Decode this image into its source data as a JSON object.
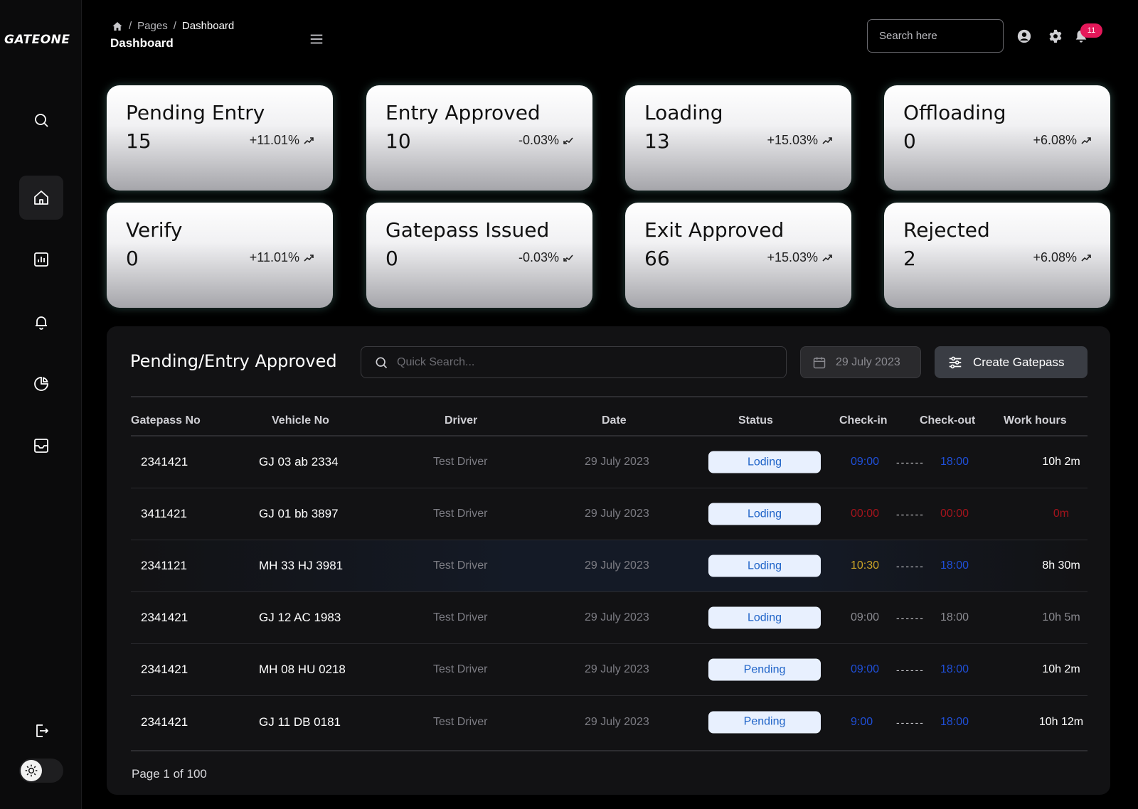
{
  "app": {
    "logo": "GATEONE"
  },
  "header": {
    "breadcrumb": [
      "Pages",
      "Dashboard"
    ],
    "title": "Dashboard",
    "search_placeholder": "Search here",
    "notification_count": "11"
  },
  "cards": [
    {
      "title": "Pending Entry",
      "value": "15",
      "change": "+11.01%",
      "trend": "up"
    },
    {
      "title": "Entry Approved",
      "value": "10",
      "change": "-0.03%",
      "trend": "down"
    },
    {
      "title": "Loading",
      "value": "13",
      "change": "+15.03%",
      "trend": "up"
    },
    {
      "title": "Offloading",
      "value": "0",
      "change": "+6.08%",
      "trend": "up"
    },
    {
      "title": "Verify",
      "value": "0",
      "change": "+11.01%",
      "trend": "up"
    },
    {
      "title": "Gatepass Issued",
      "value": "0",
      "change": "-0.03%",
      "trend": "down"
    },
    {
      "title": "Exit Approved",
      "value": "66",
      "change": "+15.03%",
      "trend": "up"
    },
    {
      "title": "Rejected",
      "value": "2",
      "change": "+6.08%",
      "trend": "up"
    }
  ],
  "table": {
    "title": "Pending/Entry Approved",
    "search_placeholder": "Quick Search...",
    "date": "29 July 2023",
    "create_label": "Create Gatepass",
    "columns": [
      "Gatepass No",
      "Vehicle No",
      "Driver",
      "Date",
      "Status",
      "Check-in",
      "Check-out",
      "Work hours"
    ],
    "separator": "------",
    "rows": [
      {
        "gatepass": "2341421",
        "vehicle": "GJ 03 ab 2334",
        "driver": "Test Driver",
        "date": "29 July 2023",
        "status": "Loding",
        "checkin": "09:00",
        "checkout": "18:00",
        "work": "10h 2m",
        "in_color": "#1f4fd8",
        "out_color": "#1f4fd8",
        "work_color": "#ffffff"
      },
      {
        "gatepass": "3411421",
        "vehicle": "GJ 01 bb 3897",
        "driver": "Test Driver",
        "date": "29 July 2023",
        "status": "Loding",
        "checkin": "00:00",
        "checkout": "00:00",
        "work": "0m",
        "in_color": "#a3141c",
        "out_color": "#a3141c",
        "work_color": "#a3141c"
      },
      {
        "gatepass": "2341121",
        "vehicle": "MH 33 HJ 3981",
        "driver": "Test Driver",
        "date": "29 July 2023",
        "status": "Loding",
        "checkin": "10:30",
        "checkout": "18:00",
        "work": "8h 30m",
        "in_color": "#c9a227",
        "out_color": "#1f4fd8",
        "work_color": "#ffffff"
      },
      {
        "gatepass": "2341421",
        "vehicle": "GJ 12 AC 1983",
        "driver": "Test Driver",
        "date": "29 July 2023",
        "status": "Loding",
        "checkin": "09:00",
        "checkout": "18:00",
        "work": "10h 5m",
        "in_color": "#8a8a90",
        "out_color": "#8a8a90",
        "work_color": "#8a8a90"
      },
      {
        "gatepass": "2341421",
        "vehicle": "MH 08 HU 0218",
        "driver": "Test Driver",
        "date": "29 July 2023",
        "status": "Pending",
        "checkin": "09:00",
        "checkout": "18:00",
        "work": "10h 2m",
        "in_color": "#1f4fd8",
        "out_color": "#1f4fd8",
        "work_color": "#ffffff"
      },
      {
        "gatepass": "2341421",
        "vehicle": "GJ 11 DB 0181",
        "driver": "Test Driver",
        "date": "29 July 2023",
        "status": "Pending",
        "checkin": "9:00",
        "checkout": "18:00",
        "work": "10h 12m",
        "in_color": "#1f4fd8",
        "out_color": "#1f4fd8",
        "work_color": "#ffffff"
      }
    ],
    "pagination": "Page 1 of 100"
  },
  "icons": {
    "sidebar": [
      "search-icon",
      "home-icon",
      "chart-icon",
      "bell-icon",
      "pie-chart-icon",
      "inbox-icon",
      "logout-icon",
      "sun-icon"
    ],
    "header": [
      "home-icon",
      "menu-icon",
      "user-icon",
      "gear-icon",
      "bell-icon"
    ]
  }
}
